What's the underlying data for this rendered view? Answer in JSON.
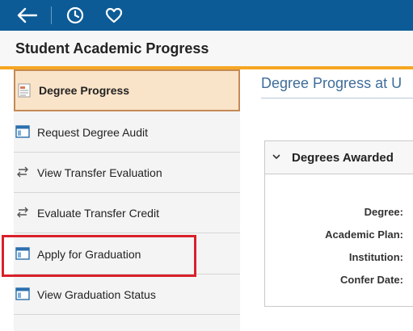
{
  "topbar": {
    "back_icon": "arrow-left-icon",
    "recent_icon": "clock-icon",
    "favorites_icon": "heart-icon"
  },
  "page": {
    "title": "Student Academic Progress"
  },
  "sidebar": {
    "items": [
      {
        "label": "Degree Progress",
        "icon": "document-icon",
        "active": true
      },
      {
        "label": "Request Degree Audit",
        "icon": "window-icon",
        "active": false
      },
      {
        "label": "View Transfer Evaluation",
        "icon": "swap-arrows-icon",
        "active": false
      },
      {
        "label": "Evaluate Transfer Credit",
        "icon": "swap-arrows-icon",
        "active": false
      },
      {
        "label": "Apply for Graduation",
        "icon": "window-icon",
        "active": false
      },
      {
        "label": "View Graduation Status",
        "icon": "window-icon",
        "active": false
      }
    ]
  },
  "content": {
    "title": "Degree Progress at U",
    "panel": {
      "heading": "Degrees Awarded",
      "fields": [
        "Degree:",
        "Academic Plan:",
        "Institution:",
        "Confer Date:"
      ]
    }
  },
  "colors": {
    "topbar": "#0c5b96",
    "accent_bar": "#f6a623",
    "active_item_bg": "#fae4c9",
    "highlight_box": "#d9202a",
    "content_title": "#3e6d99"
  }
}
